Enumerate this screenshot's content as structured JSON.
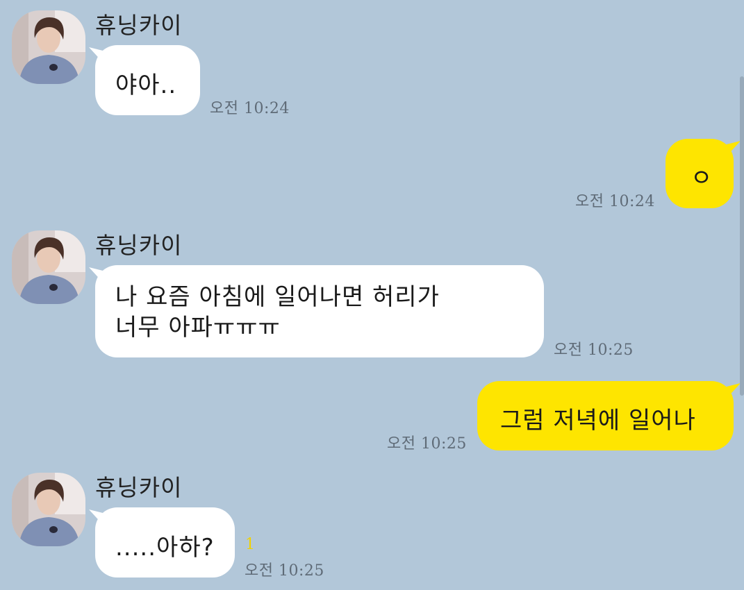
{
  "chat": {
    "groups": [
      {
        "sender": "휴닝카이",
        "message": "야아..",
        "time": "오전 10:24"
      },
      {
        "message": "ㅇ",
        "time": "오전 10:24"
      },
      {
        "sender": "휴닝카이",
        "message": "나 요즘 아침에 일어나면 허리가\n너무 아파ㅠㅠㅠ",
        "time": "오전 10:25"
      },
      {
        "message": "그럼 저녁에 일어나",
        "time": "오전 10:25"
      },
      {
        "sender": "휴닝카이",
        "message": ".....아하?",
        "time": "오전 10:25",
        "unread": "1"
      }
    ]
  },
  "colors": {
    "background": "#b2c7d9",
    "incoming_bubble": "#ffffff",
    "outgoing_bubble": "#fee500",
    "unread_count": "#f1d200"
  },
  "icons": {
    "avatar": "profile-photo"
  }
}
